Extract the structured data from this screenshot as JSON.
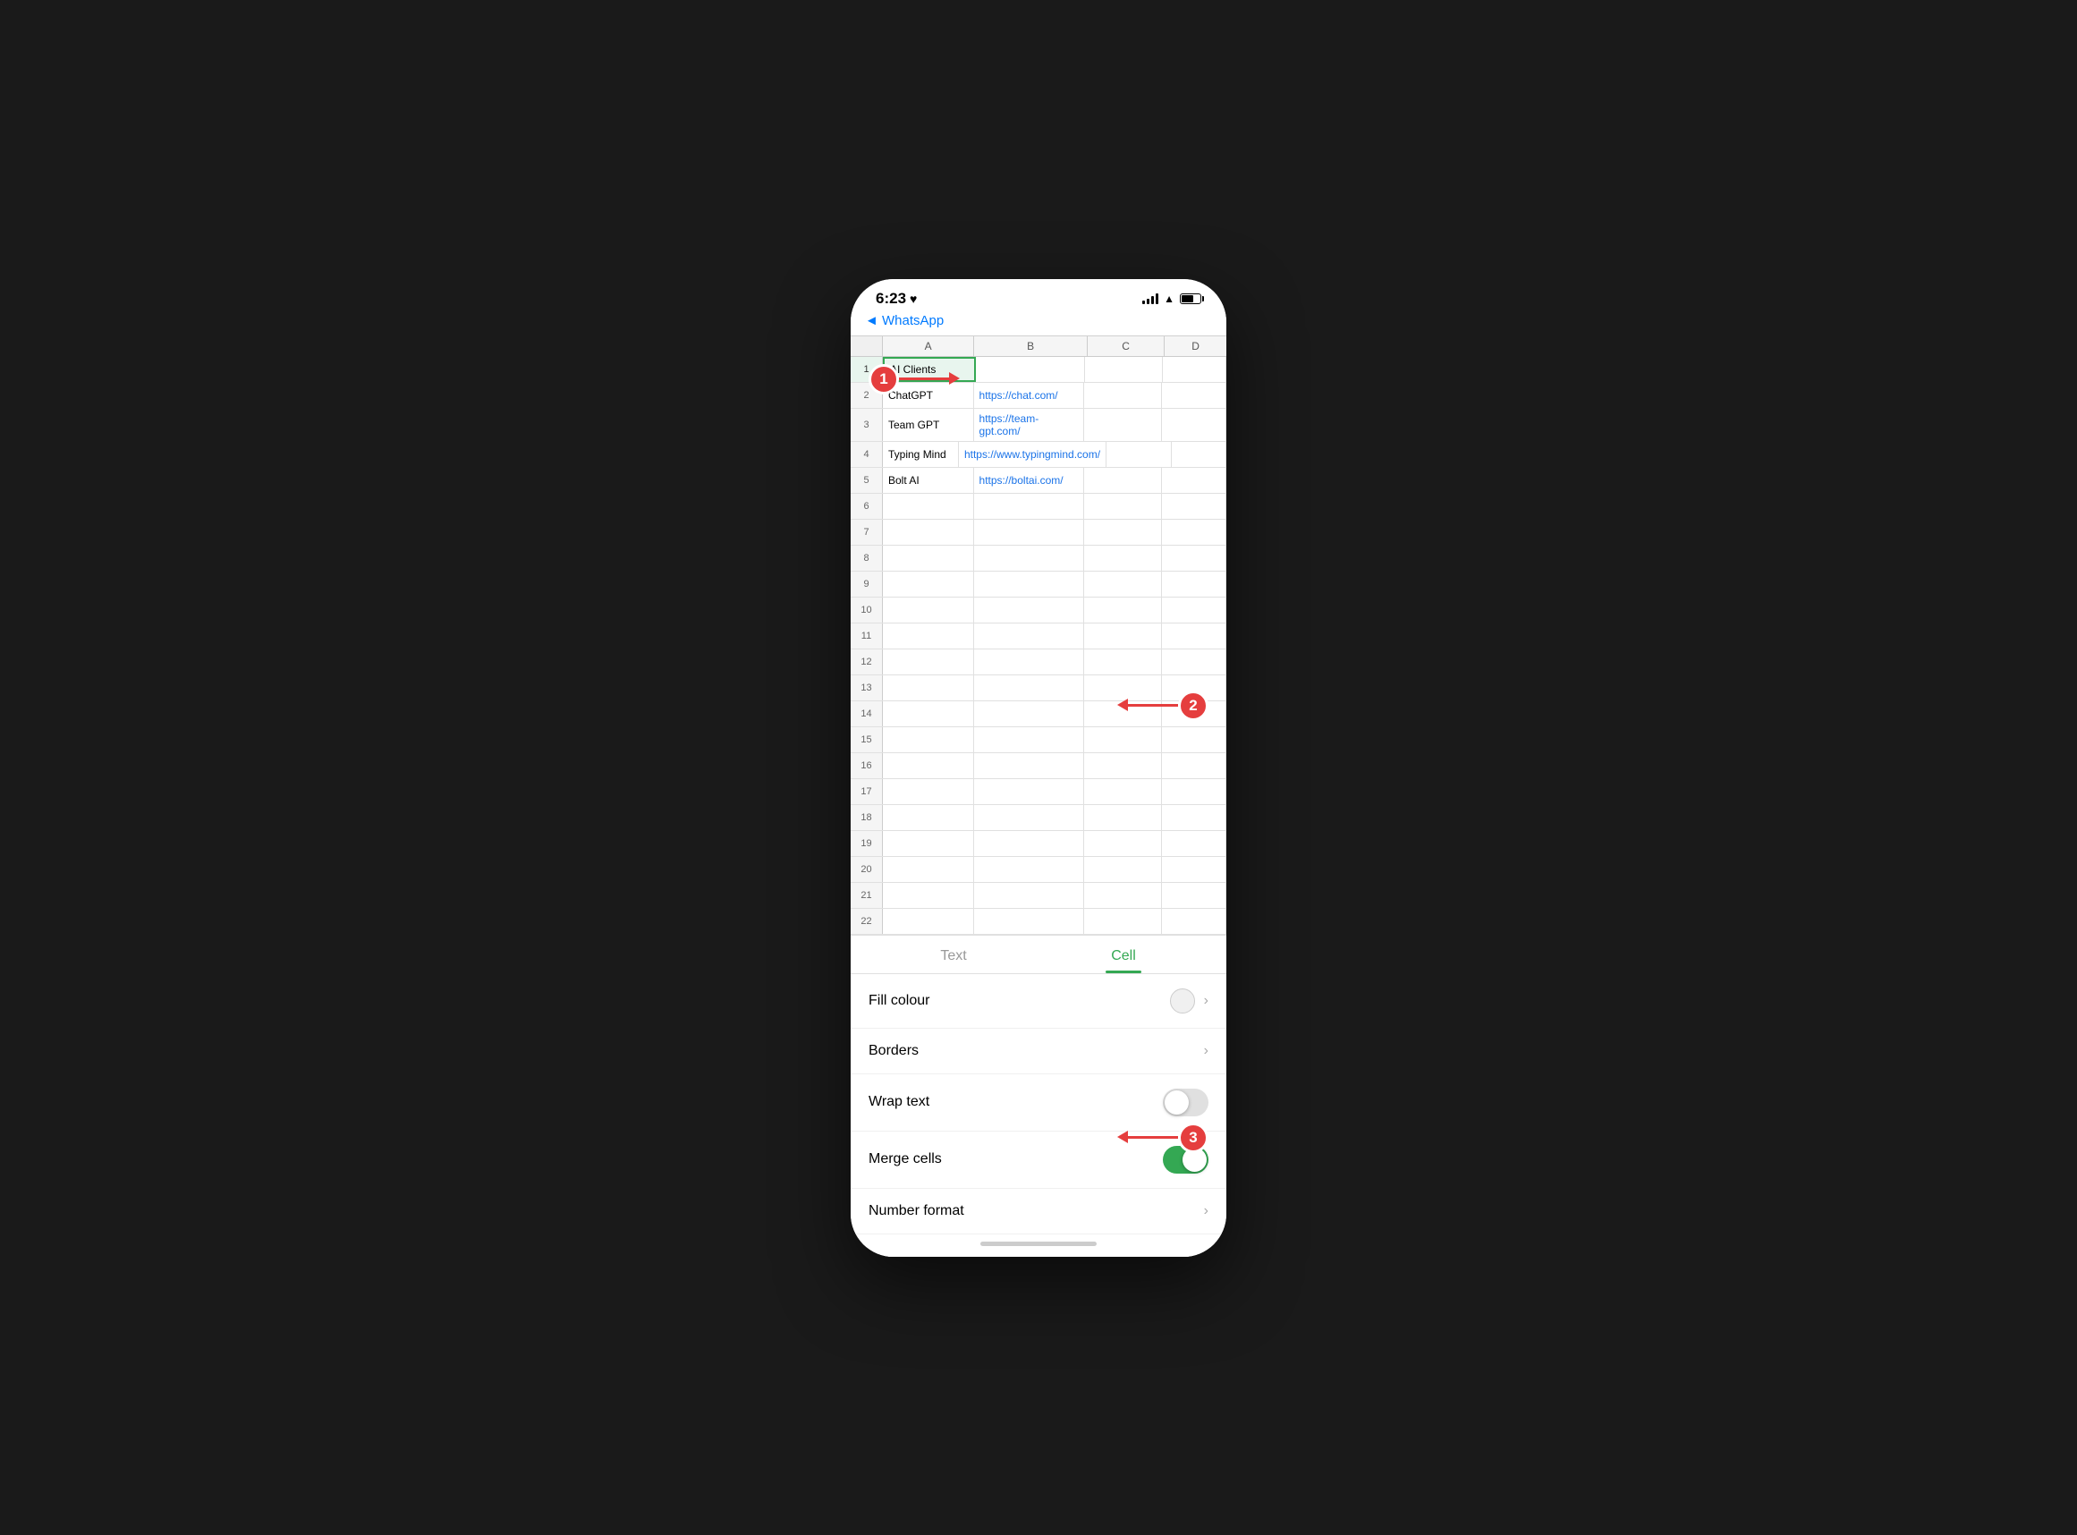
{
  "statusBar": {
    "time": "6:23",
    "heartIcon": "♥",
    "backLabel": "◄ WhatsApp"
  },
  "spreadsheet": {
    "columns": [
      "A",
      "B",
      "C",
      "D"
    ],
    "rows": [
      {
        "num": 1,
        "a": "AI Clients",
        "b": "",
        "c": "",
        "d": "",
        "selected": true
      },
      {
        "num": 2,
        "a": "ChatGPT",
        "b": "https://chat.com/",
        "c": "",
        "d": "",
        "isLink": true
      },
      {
        "num": 3,
        "a": "Team GPT",
        "b": "https://team-gpt.com/",
        "c": "",
        "d": "",
        "isLink": true
      },
      {
        "num": 4,
        "a": "Typing Mind",
        "b": "https://www.typingmind.com/",
        "c": "",
        "d": "",
        "isLink": true
      },
      {
        "num": 5,
        "a": "Bolt AI",
        "b": "https://boltai.com/",
        "c": "",
        "d": "",
        "isLink": true
      },
      {
        "num": 6,
        "a": "",
        "b": "",
        "c": "",
        "d": ""
      },
      {
        "num": 7,
        "a": "",
        "b": "",
        "c": "",
        "d": ""
      },
      {
        "num": 8,
        "a": "",
        "b": "",
        "c": "",
        "d": ""
      },
      {
        "num": 9,
        "a": "",
        "b": "",
        "c": "",
        "d": ""
      },
      {
        "num": 10,
        "a": "",
        "b": "",
        "c": "",
        "d": ""
      },
      {
        "num": 11,
        "a": "",
        "b": "",
        "c": "",
        "d": ""
      },
      {
        "num": 12,
        "a": "",
        "b": "",
        "c": "",
        "d": ""
      },
      {
        "num": 13,
        "a": "",
        "b": "",
        "c": "",
        "d": ""
      },
      {
        "num": 14,
        "a": "",
        "b": "",
        "c": "",
        "d": ""
      },
      {
        "num": 15,
        "a": "",
        "b": "",
        "c": "",
        "d": ""
      },
      {
        "num": 16,
        "a": "",
        "b": "",
        "c": "",
        "d": ""
      },
      {
        "num": 17,
        "a": "",
        "b": "",
        "c": "",
        "d": ""
      },
      {
        "num": 18,
        "a": "",
        "b": "",
        "c": "",
        "d": ""
      },
      {
        "num": 19,
        "a": "",
        "b": "",
        "c": "",
        "d": ""
      },
      {
        "num": 20,
        "a": "",
        "b": "",
        "c": "",
        "d": ""
      },
      {
        "num": 21,
        "a": "",
        "b": "",
        "c": "",
        "d": ""
      },
      {
        "num": 22,
        "a": "",
        "b": "",
        "c": "",
        "d": ""
      }
    ]
  },
  "bottomPanel": {
    "tabs": [
      {
        "label": "Text",
        "active": false
      },
      {
        "label": "Cell",
        "active": true
      }
    ],
    "menuItems": [
      {
        "label": "Fill colour",
        "type": "color-chevron"
      },
      {
        "label": "Borders",
        "type": "chevron"
      },
      {
        "label": "Wrap text",
        "type": "toggle",
        "toggleOn": false
      },
      {
        "label": "Merge cells",
        "type": "toggle",
        "toggleOn": true
      },
      {
        "label": "Number format",
        "type": "chevron"
      }
    ]
  },
  "annotations": [
    {
      "number": "1"
    },
    {
      "number": "2"
    },
    {
      "number": "3"
    }
  ]
}
